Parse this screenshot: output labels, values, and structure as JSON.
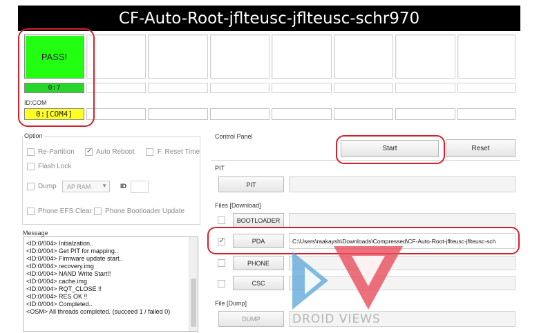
{
  "window": {
    "title": "CF-Auto-Root-jflteusc-jflteusc-schr970"
  },
  "slots": {
    "status": [
      "PASS!",
      "",
      "",
      "",
      "",
      "",
      "",
      ""
    ],
    "progress": [
      "0:7",
      "",
      "",
      "",
      "",
      "",
      "",
      ""
    ],
    "idcom_label": "ID:COM",
    "ports": [
      "0:[COM4]",
      "",
      "",
      "",
      "",
      "",
      "",
      ""
    ]
  },
  "option": {
    "title": "Option",
    "re_partition": {
      "label": "Re-Partition",
      "checked": false
    },
    "auto_reboot": {
      "label": "Auto Reboot",
      "checked": true
    },
    "f_reset_time": {
      "label": "F. Reset Time",
      "checked": false
    },
    "flash_lock": {
      "label": "Flash Lock",
      "checked": false
    },
    "dump": {
      "label": "Dump",
      "checked": false
    },
    "dump_target": "AP RAM",
    "id_label": "ID",
    "phone_efs_clear": {
      "label": "Phone EFS Clear",
      "checked": false
    },
    "phone_bootloader_update": {
      "label": "Phone Bootloader Update",
      "checked": false
    }
  },
  "message": {
    "title": "Message",
    "lines": [
      "<ID:0/004> Initialzation..",
      "<ID:0/004> Get PIT for mapping..",
      "<ID:0/004> Firmware update start..",
      "<ID:0/004> recovery.img",
      "<ID:0/004> NAND Write Start!!",
      "<ID:0/004> cache.img",
      "<ID:0/004> RQT_CLOSE !!",
      "<ID:0/004> RES OK !!",
      "<ID:0/004> Completed..",
      "<OSM> All threads completed. (succeed 1 / failed 0)"
    ]
  },
  "control_panel": {
    "title": "Control Panel",
    "start": "Start",
    "reset": "Reset"
  },
  "pit": {
    "title": "PIT",
    "button": "PIT"
  },
  "files": {
    "title": "Files [Download]",
    "bootloader": {
      "label": "BOOTLOADER",
      "checked": false,
      "path": ""
    },
    "pda": {
      "label": "PDA",
      "checked": true,
      "path": "C:\\Users\\raakaysh\\Downloads\\Compressed\\CF-Auto-Root-jflteusc-jflteusc-sch"
    },
    "phone": {
      "label": "PHONE",
      "checked": false,
      "path": ""
    },
    "csc": {
      "label": "CSC",
      "checked": false,
      "path": ""
    }
  },
  "file_dump": {
    "title": "File [Dump]",
    "button": "DUMP"
  },
  "watermark": {
    "text": "DROID VIEWS",
    "colors": [
      "#e84c5c",
      "#5aa6d8"
    ]
  }
}
